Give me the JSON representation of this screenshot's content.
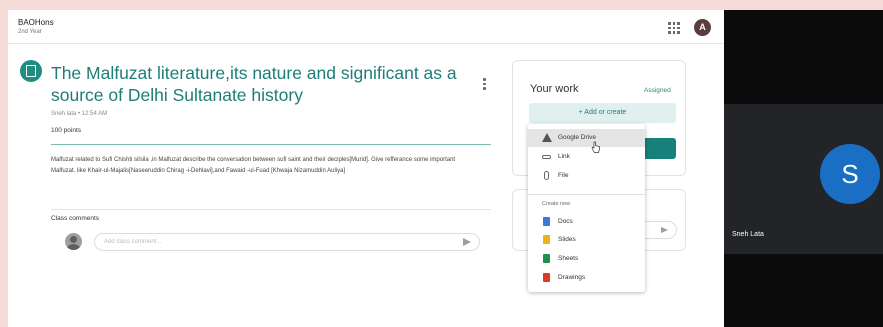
{
  "header": {
    "class_name": "BAOHons",
    "class_section": "2nd Year",
    "user_initial": "A"
  },
  "assignment": {
    "title": "The Malfuzat literature,its nature and significant as a source of Delhi Sultanate history",
    "meta": "Sneh lata • 12:54 AM",
    "points": "100 points",
    "description": "Malfuzat related to Sufi Chishti silsila ,in Malfuzat describe the conversation between sufi saint and their deciples[Murid]. Give refferance some important Malfuzat. like Khair-ul-Majalis[Naseeruddin Chirag -i-Dehlavi],and Fawaid -ul-Fuad [Khwaja Nizamuddin Auliya]",
    "class_comments_label": "Class comments",
    "comment_placeholder": "Add class comment..."
  },
  "your_work": {
    "title": "Your work",
    "status": "Assigned",
    "add_create_label": "+ Add or create"
  },
  "menu": {
    "items": [
      {
        "label": "Google Drive",
        "icon": "drive-icon"
      },
      {
        "label": "Link",
        "icon": "link-icon"
      },
      {
        "label": "File",
        "icon": "file-icon"
      }
    ],
    "create_new_label": "Create new",
    "create_items": [
      {
        "label": "Docs",
        "icon": "docs-icon"
      },
      {
        "label": "Slides",
        "icon": "slides-icon"
      },
      {
        "label": "Sheets",
        "icon": "sheets-icon"
      },
      {
        "label": "Drawings",
        "icon": "drawings-icon"
      }
    ]
  },
  "video": {
    "participant_initial": "S",
    "participant_name": "Sneh Lata"
  },
  "colors": {
    "accent": "#1e7e77",
    "background": "#f6dcd9",
    "avatar_blue": "#1a6fc4"
  }
}
